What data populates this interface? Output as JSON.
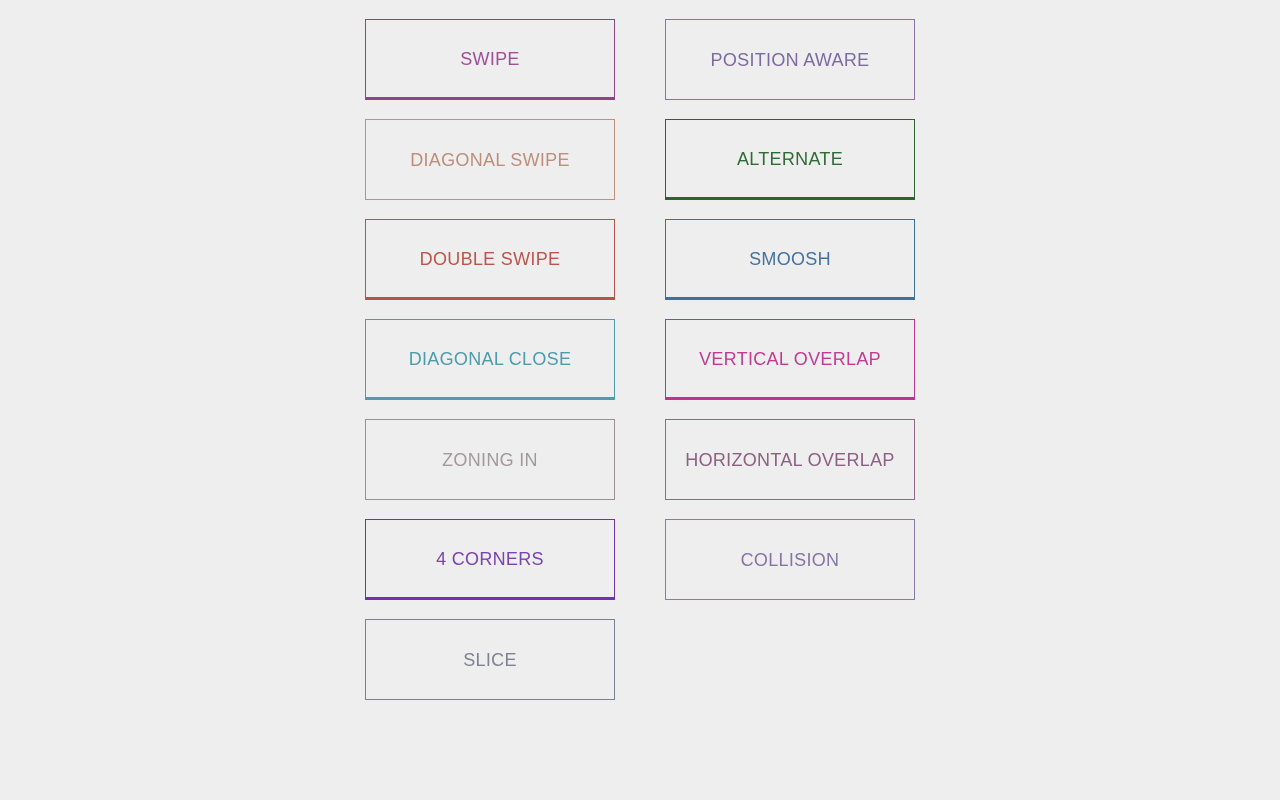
{
  "page": {
    "background_color": "#eeeeee",
    "columns": 2
  },
  "cards": [
    {
      "label": "SWIPE",
      "column": "left",
      "row": 1,
      "border_color": "#8e4585",
      "text_color": "#9e4f95",
      "thick_bottom": true
    },
    {
      "label": "POSITION AWARE",
      "column": "right",
      "row": 1,
      "border_color": "#8b73a8",
      "text_color": "#7d6aa0",
      "thick_bottom": false
    },
    {
      "label": "DIAGONAL SWIPE",
      "column": "left",
      "row": 2,
      "border_color": "#c09178",
      "text_color": "#bd8e79",
      "thick_bottom": false
    },
    {
      "label": "ALTERNATE",
      "column": "right",
      "row": 2,
      "border_color": "#2d6332",
      "text_color": "#2f6b35",
      "thick_bottom": true
    },
    {
      "label": "DOUBLE SWIPE",
      "column": "left",
      "row": 3,
      "border_color": "#b5544a",
      "text_color": "#b9564c",
      "thick_bottom": true
    },
    {
      "label": "SMOOSH",
      "column": "right",
      "row": 3,
      "border_color": "#3f6f9c",
      "text_color": "#45719e",
      "thick_bottom": true
    },
    {
      "label": "DIAGONAL CLOSE",
      "column": "left",
      "row": 4,
      "border_color": "#4e9dab",
      "text_color": "#4d9cab",
      "thick_bottom": true
    },
    {
      "label": "VERTICAL OVERLAP",
      "column": "right",
      "row": 4,
      "border_color": "#b8378b",
      "text_color": "#c23b92",
      "thick_bottom": true
    },
    {
      "label": "ZONING IN",
      "column": "left",
      "row": 5,
      "border_color": "#9c8f92",
      "text_color": "#a2999c",
      "thick_bottom": false
    },
    {
      "label": "HORIZONTAL OVERLAP",
      "column": "right",
      "row": 5,
      "border_color": "#8e6b85",
      "text_color": "#8b6081",
      "thick_bottom": false
    },
    {
      "label": "4 CORNERS",
      "column": "left",
      "row": 6,
      "border_color": "#6d35a8",
      "text_color": "#7a43b0",
      "thick_bottom": true
    },
    {
      "label": "COLLISION",
      "column": "right",
      "row": 6,
      "border_color": "#8a7aa8",
      "text_color": "#8376a4",
      "thick_bottom": false
    },
    {
      "label": "SLICE",
      "column": "left",
      "row": 7,
      "border_color": "#7b8190",
      "text_color": "#7e838f",
      "thick_bottom": false
    }
  ]
}
